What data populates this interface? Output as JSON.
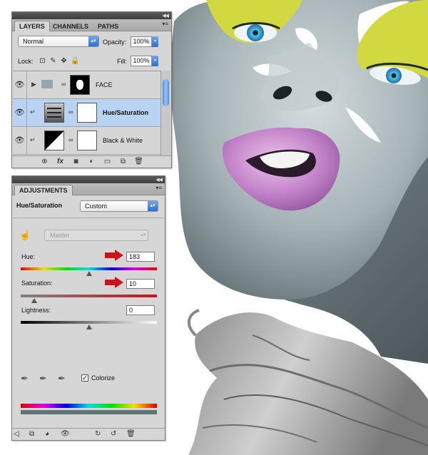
{
  "layers_panel": {
    "tabs": [
      {
        "label": "LAYERS",
        "active": true
      },
      {
        "label": "CHANNELS",
        "active": false
      },
      {
        "label": "PATHS",
        "active": false
      }
    ],
    "blend_mode": "Normal",
    "opacity_label": "Opacity:",
    "opacity_value": "100%",
    "lock_label": "Lock:",
    "fill_label": "Fill:",
    "fill_value": "100%",
    "layers": [
      {
        "name": "FACE",
        "type": "group",
        "selected": false
      },
      {
        "name": "Hue/Saturation",
        "type": "adjustment",
        "selected": true
      },
      {
        "name": "Black & White",
        "type": "adjustment",
        "selected": false
      }
    ],
    "footer_icons": [
      "link-icon",
      "fx-icon",
      "mask-icon",
      "adjustment-icon",
      "folder-icon",
      "new-layer-icon",
      "trash-icon"
    ]
  },
  "adjustments_panel": {
    "tab_label": "ADJUSTMENTS",
    "title": "Hue/Saturation",
    "preset_value": "Custom",
    "channel_value": "Master",
    "hue_label": "Hue:",
    "hue_value": "183",
    "saturation_label": "Saturation:",
    "saturation_value": "10",
    "lightness_label": "Lightness:",
    "lightness_value": "0",
    "colorize_label": "Colorize",
    "colorize_checked": true,
    "hue_slider_level": 0.5,
    "saturation_slider_level": 0.1,
    "lightness_slider_level": 0.5,
    "accent_arrow_color": "#c8141b",
    "footer_icons": [
      "back-icon",
      "clip-icon",
      "view-previous-icon",
      "visibility-icon",
      "reset-icon",
      "refresh-icon",
      "trash-icon"
    ]
  },
  "colors": {
    "selected_row": "#b9d3f3",
    "lip_color": "#c885c9",
    "eyeshadow_color": "#d2d83f",
    "iris_color": "#3d9fd8"
  }
}
